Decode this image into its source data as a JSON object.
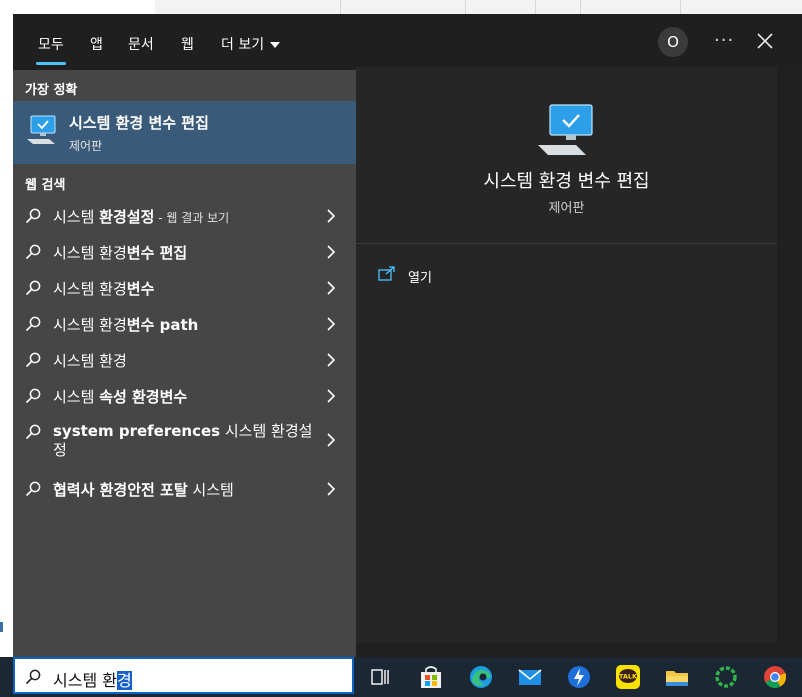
{
  "tabs": [
    {
      "label": "모두",
      "active": true
    },
    {
      "label": "앱"
    },
    {
      "label": "문서"
    },
    {
      "label": "웹"
    },
    {
      "label": "더 보기"
    }
  ],
  "header": {
    "avatar_letter": "O",
    "more_label": "···"
  },
  "best_match": {
    "section_title": "가장 정확",
    "title": "시스템 환경 변수 편집",
    "subtitle": "제어판",
    "icon": "system-monitor-icon"
  },
  "web_search": {
    "section_title": "웹 검색",
    "items": [
      {
        "normal": "시스템 ",
        "bold": "환경설정",
        "suffix": " - 웹 결과 보기"
      },
      {
        "normal": "시스템 환경",
        "bold": "변수 편집",
        "suffix": ""
      },
      {
        "normal": "시스템 환경",
        "bold": "변수",
        "suffix": ""
      },
      {
        "normal": "시스템 환경",
        "bold": "변수 path",
        "suffix": ""
      },
      {
        "normal": "시스템 환경",
        "bold": "",
        "suffix": ""
      },
      {
        "normal": "시스템 ",
        "bold": "속성 환경변수",
        "suffix": ""
      },
      {
        "normal": "",
        "bold": "system preferences",
        "after": " 시스템 환경설정",
        "suffix": ""
      },
      {
        "normal": "",
        "bold": "협력사 환경안전 포탈",
        "after": " 시스템",
        "suffix": ""
      }
    ]
  },
  "preview": {
    "title": "시스템 환경 변수 편집",
    "subtitle": "제어판",
    "action_open": "열기",
    "icon": "system-monitor-icon"
  },
  "taskbar": {
    "search_typed": "시스템 환",
    "search_selected": "경",
    "icons": [
      "task-view-icon",
      "store-icon",
      "edge-icon",
      "mail-icon",
      "app-blue-icon",
      "kakaotalk-icon",
      "file-explorer-icon",
      "green-ring-icon",
      "chrome-icon"
    ],
    "kakao_label": "TALK"
  },
  "colors": {
    "accent": "#4cc2ff",
    "best_match_bg": "#3a5a7a",
    "left_pane": "#464646",
    "right_pane": "#262626"
  }
}
